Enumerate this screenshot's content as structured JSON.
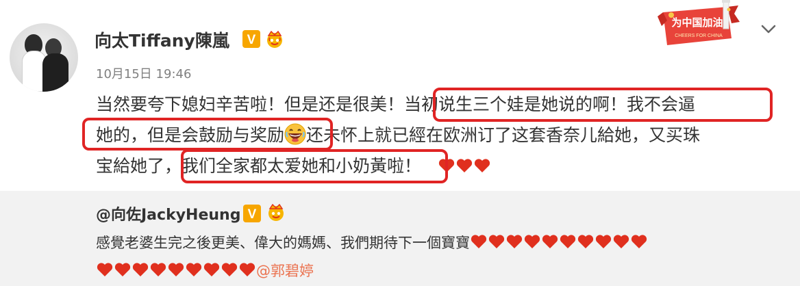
{
  "post": {
    "username": "向太Tiffany陳嵐",
    "date": "10月15日",
    "time": "19:46",
    "text_line1_a": "当然要夸下媳妇辛苦啦！但是还是很美！",
    "text_line1_b": "当初说生三个娃是她说的啊！我不会逼",
    "text_line2_a": "她的，但是会鼓励与奖励",
    "text_line2_b": "还未怀上就已經在欧洲订了这套香奈儿給她，又买珠",
    "text_line3_a": "宝給她了，",
    "text_line3_b": "我们全家都太爱她和小奶黃啦！",
    "highlight_color": "#e02424",
    "verified_badge": "V",
    "icons": [
      "grinning-emoji-icon",
      "heart-icon",
      "crown-icon",
      "chevron-down-icon"
    ]
  },
  "banner": {
    "title": "为中国加油",
    "subtitle": "CHEERS FOR CHINA"
  },
  "repost": {
    "username": "@向佐JackyHeung",
    "text_line1": "感覺老婆生完之後更美、偉大的媽媽、我們期待下一個寶寶",
    "mention": "@郭碧婷",
    "hearts_line1": 10,
    "hearts_line2": 9,
    "verified_badge": "V"
  },
  "colors": {
    "accent": "#eb7350",
    "heart": "#e0301e",
    "repost_bg": "#f2f2f2",
    "verified": "#f7a600"
  }
}
